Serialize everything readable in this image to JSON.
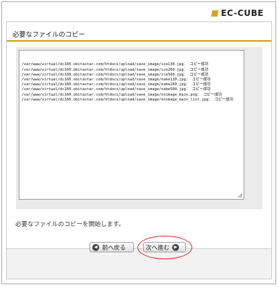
{
  "logo": {
    "text": "EC-CUBE"
  },
  "panel": {
    "title": "必要なファイルのコピー"
  },
  "log": {
    "lines": [
      "/var/www/virtual/dc160.obitastar.com/htdocs/upload/save_image/ice130.jpg： コピー成功",
      "/var/www/virtual/dc160.obitastar.com/htdocs/upload/save_image/ice260.jpg： コピー成功",
      "/var/www/virtual/dc160.obitastar.com/htdocs/upload/save_image/ice500.jpg： コピー成功",
      "/var/www/virtual/dc160.obitastar.com/htdocs/upload/save_image/nabe130.jpg： コピー成功",
      "/var/www/virtual/dc160.obitastar.com/htdocs/upload/save_image/nabe260.jpg： コピー成功",
      "/var/www/virtual/dc160.obitastar.com/htdocs/upload/save_image/nabe500.jpg： コピー成功",
      "/var/www/virtual/dc160.obitastar.com/htdocs/upload/save_image/noimage_main.png： コピー成功",
      "/var/www/virtual/dc160.obitastar.com/htdocs/upload/save_image/noimage_main_list.jpg： コピー成功"
    ]
  },
  "status": {
    "text": "必要なファイルのコピーを開始します。"
  },
  "buttons": {
    "back_label": "前へ戻る",
    "next_label": "次へ進む",
    "back_icon": "arrow-left-icon",
    "next_icon": "arrow-right-icon"
  },
  "colors": {
    "accent": "#d39a0f",
    "highlight": "#d81f1f"
  }
}
